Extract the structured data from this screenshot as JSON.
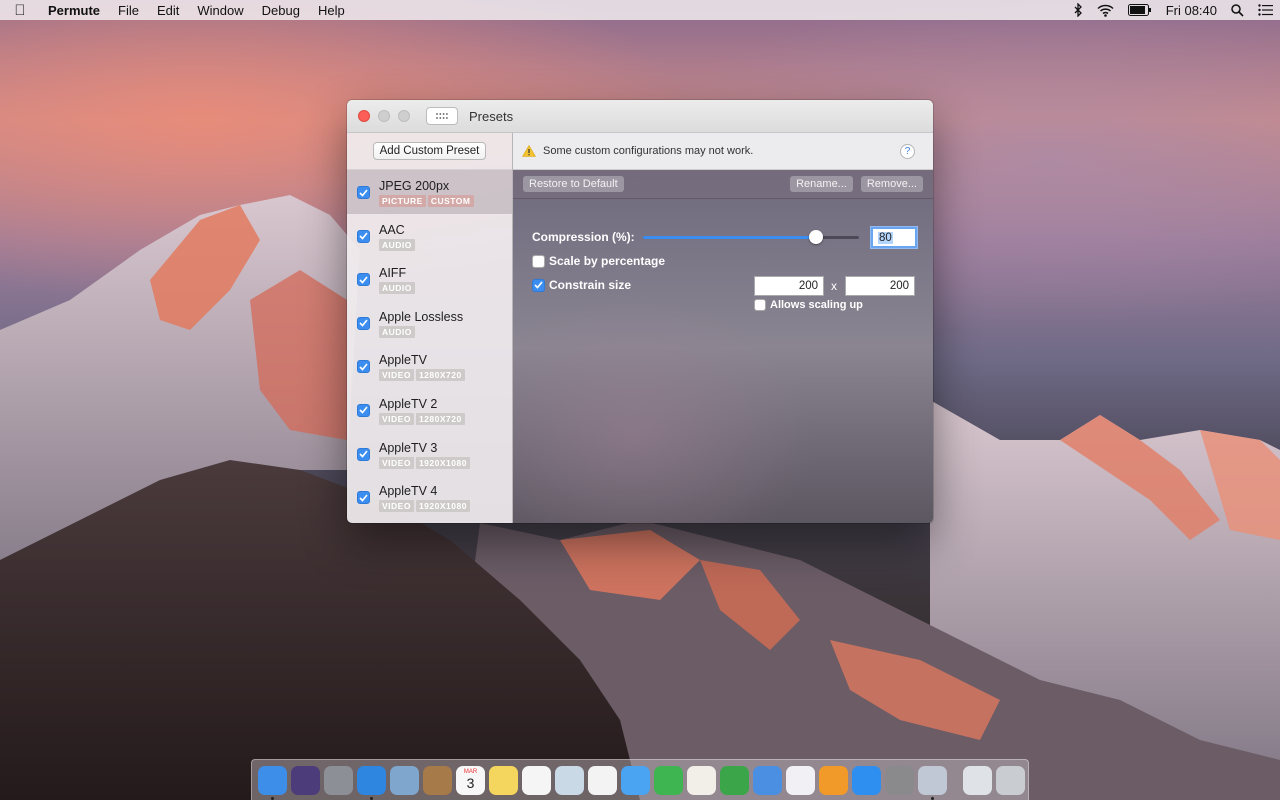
{
  "menubar": {
    "app_name": "Permute",
    "menus": [
      "File",
      "Edit",
      "Window",
      "Debug",
      "Help"
    ],
    "clock": "Fri 08:40"
  },
  "window": {
    "title": "Presets",
    "add_button": "Add Custom Preset",
    "warning": "Some custom configurations may not work.",
    "help": "?",
    "restore_button": "Restore to Default",
    "rename_button": "Rename...",
    "remove_button": "Remove..."
  },
  "presets": [
    {
      "name": "JPEG 200px",
      "tags": [
        "PICTURE",
        "CUSTOM"
      ],
      "checked": true,
      "selected": true
    },
    {
      "name": "AAC",
      "tags": [
        "AUDIO"
      ],
      "checked": true
    },
    {
      "name": "AIFF",
      "tags": [
        "AUDIO"
      ],
      "checked": true
    },
    {
      "name": "Apple Lossless",
      "tags": [
        "AUDIO"
      ],
      "checked": true
    },
    {
      "name": "AppleTV",
      "tags": [
        "VIDEO",
        "1280X720"
      ],
      "checked": true
    },
    {
      "name": "AppleTV 2",
      "tags": [
        "VIDEO",
        "1280X720"
      ],
      "checked": true
    },
    {
      "name": "AppleTV 3",
      "tags": [
        "VIDEO",
        "1920X1080"
      ],
      "checked": true
    },
    {
      "name": "AppleTV 4",
      "tags": [
        "VIDEO",
        "1920X1080"
      ],
      "checked": true
    }
  ],
  "settings": {
    "compression_label": "Compression (%):",
    "compression_value": "80",
    "compression_fraction": 0.8,
    "scale_label": "Scale by percentage",
    "scale_checked": false,
    "constrain_label": "Constrain size",
    "constrain_checked": true,
    "width": "200",
    "times": "x",
    "height": "200",
    "allow_scaling_label": "Allows scaling up",
    "allow_scaling_checked": false
  },
  "dock": {
    "apps": [
      {
        "name": "finder-icon",
        "color": "#3d8ee8"
      },
      {
        "name": "siri-icon",
        "color": "#4c3d7a"
      },
      {
        "name": "launchpad-icon",
        "color": "#8d8f96"
      },
      {
        "name": "safari-icon",
        "color": "#2f86e0"
      },
      {
        "name": "mail-icon",
        "color": "#7fa6cc"
      },
      {
        "name": "contacts-icon",
        "color": "#a77a4a"
      },
      {
        "name": "calendar-icon",
        "color": "#f7f7f7"
      },
      {
        "name": "notes-icon",
        "color": "#f4d55d"
      },
      {
        "name": "reminders-icon",
        "color": "#f5f5f5"
      },
      {
        "name": "preview-icon",
        "color": "#c9d9e6"
      },
      {
        "name": "photos-icon",
        "color": "#f3f3f3"
      },
      {
        "name": "messages-icon",
        "color": "#4aa4f2"
      },
      {
        "name": "facetime-icon",
        "color": "#3fb551"
      },
      {
        "name": "textedit-icon",
        "color": "#f1efe8"
      },
      {
        "name": "numbers-icon",
        "color": "#3ba54a"
      },
      {
        "name": "keynote-icon",
        "color": "#4b8fe2"
      },
      {
        "name": "itunes-icon",
        "color": "#f1f1f5"
      },
      {
        "name": "ibooks-icon",
        "color": "#f29a29"
      },
      {
        "name": "app-store-icon",
        "color": "#2e8ff0"
      },
      {
        "name": "system-preferences-icon",
        "color": "#8a8a8d"
      },
      {
        "name": "permute-icon",
        "color": "#bfc8d4"
      },
      {
        "name": "quicktime-icon",
        "color": "#dfe3e8"
      },
      {
        "name": "trash-icon",
        "color": "#c9ccd1"
      }
    ],
    "calendar_day": "3",
    "calendar_month": "MAR"
  }
}
